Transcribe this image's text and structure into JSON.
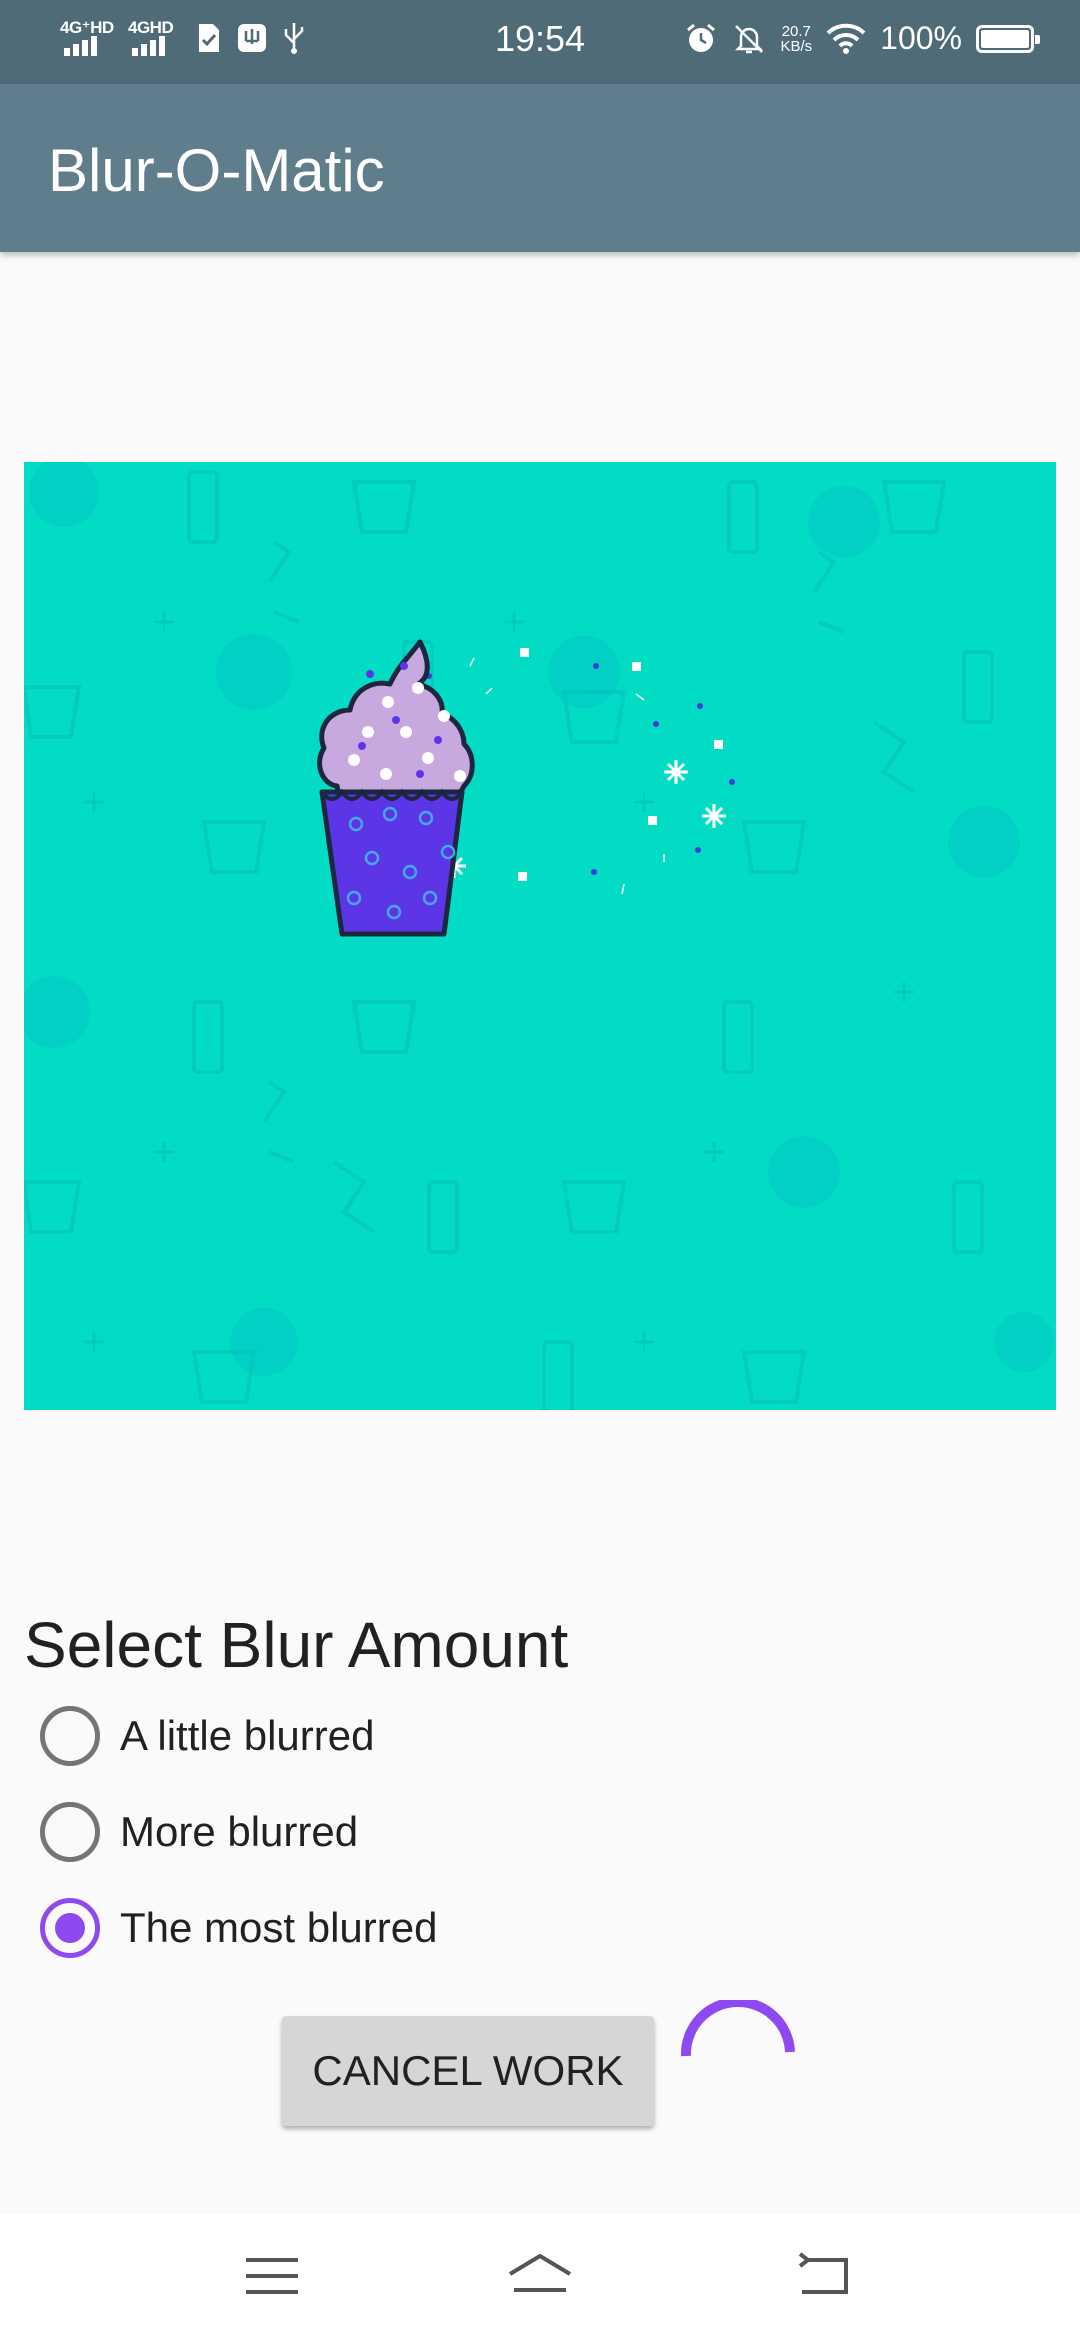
{
  "status_bar": {
    "signal1_label": "4G⁺HD",
    "signal2_label": "4GHD",
    "clock": "19:54",
    "net_speed_value": "20.7",
    "net_speed_unit": "KB/s",
    "battery_percent": "100%"
  },
  "app_bar": {
    "title": "Blur-O-Matic"
  },
  "blur_section": {
    "title": "Select Blur Amount",
    "options": [
      {
        "label": "A little blurred",
        "checked": false
      },
      {
        "label": "More blurred",
        "checked": false
      },
      {
        "label": "The most blurred",
        "checked": true
      }
    ]
  },
  "actions": {
    "cancel_label": "CANCEL WORK"
  },
  "colors": {
    "accent": "#8e49f0",
    "app_bar": "#607d8b",
    "status_bar": "#4f6b78",
    "image_bg": "#03dcc4"
  }
}
